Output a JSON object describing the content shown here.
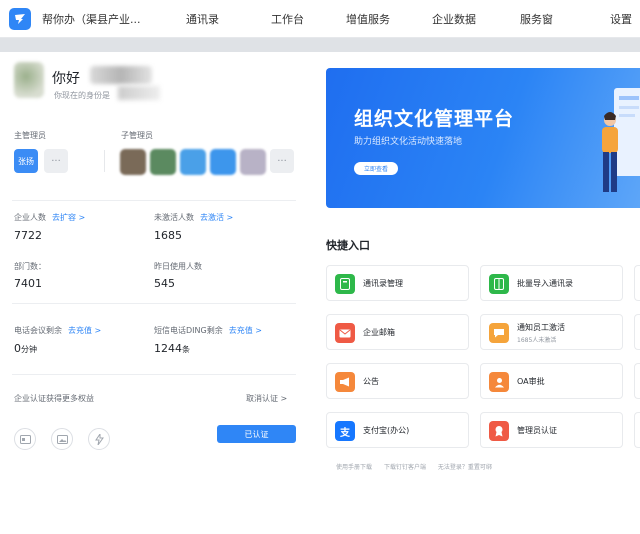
{
  "header": {
    "org_name": "帮你办（渠县产业...",
    "nav": [
      "通讯录",
      "工作台",
      "增值服务",
      "企业数据",
      "服务窗",
      "设置"
    ]
  },
  "profile": {
    "greeting": "你好",
    "identity_text": "你现在的身份是"
  },
  "admins": {
    "main_label": "主管理员",
    "main_chip": "张扬",
    "sub_label": "子管理员",
    "more": "···"
  },
  "stats": [
    {
      "label": "企业人数",
      "link": "去扩容 >",
      "value": "7722",
      "unit": ""
    },
    {
      "label": "未激活人数",
      "link": "去激活 >",
      "value": "1685",
      "unit": ""
    },
    {
      "label": "部门数：",
      "link": "",
      "value": "7401",
      "unit": ""
    },
    {
      "label": "昨日使用人数",
      "link": "",
      "value": "545",
      "unit": ""
    },
    {
      "label": "电话会议剩余",
      "link": "去充值 >",
      "value": "0",
      "unit": "分钟"
    },
    {
      "label": "短信电话DING剩余",
      "link": "去充值 >",
      "value": "1244",
      "unit": "条"
    }
  ],
  "certification": {
    "text": "企业认证获得更多权益",
    "cancel": "取消认证 >",
    "button": "已认证"
  },
  "banner": {
    "title": "组织文化管理平台",
    "subtitle": "助力组织文化活动快速落地",
    "button": "立即查看"
  },
  "quick": {
    "title": "快捷入口",
    "items": [
      {
        "label": "通讯录管理",
        "sub": "",
        "icon": "contacts-icon",
        "color": "#2eb84a"
      },
      {
        "label": "批量导入通讯录",
        "sub": "",
        "icon": "import-icon",
        "color": "#2eb84a"
      },
      {
        "label": "企业邮箱",
        "sub": "",
        "icon": "mail-icon",
        "color": "#ef5a45"
      },
      {
        "label": "通知员工激活",
        "sub": "1685人未激活",
        "icon": "notify-icon",
        "color": "#f5a43b"
      },
      {
        "label": "公告",
        "sub": "",
        "icon": "megaphone-icon",
        "color": "#f5883b"
      },
      {
        "label": "OA审批",
        "sub": "",
        "icon": "approval-icon",
        "color": "#f5883b"
      },
      {
        "label": "支付宝(办公)",
        "sub": "",
        "icon": "alipay-icon",
        "color": "#1677ff"
      },
      {
        "label": "管理员认证",
        "sub": "",
        "icon": "badge-icon",
        "color": "#ef5a45"
      }
    ],
    "footer": [
      "使用手册下载",
      "下载钉钉客户端",
      "无法登录？重置可绑"
    ]
  }
}
